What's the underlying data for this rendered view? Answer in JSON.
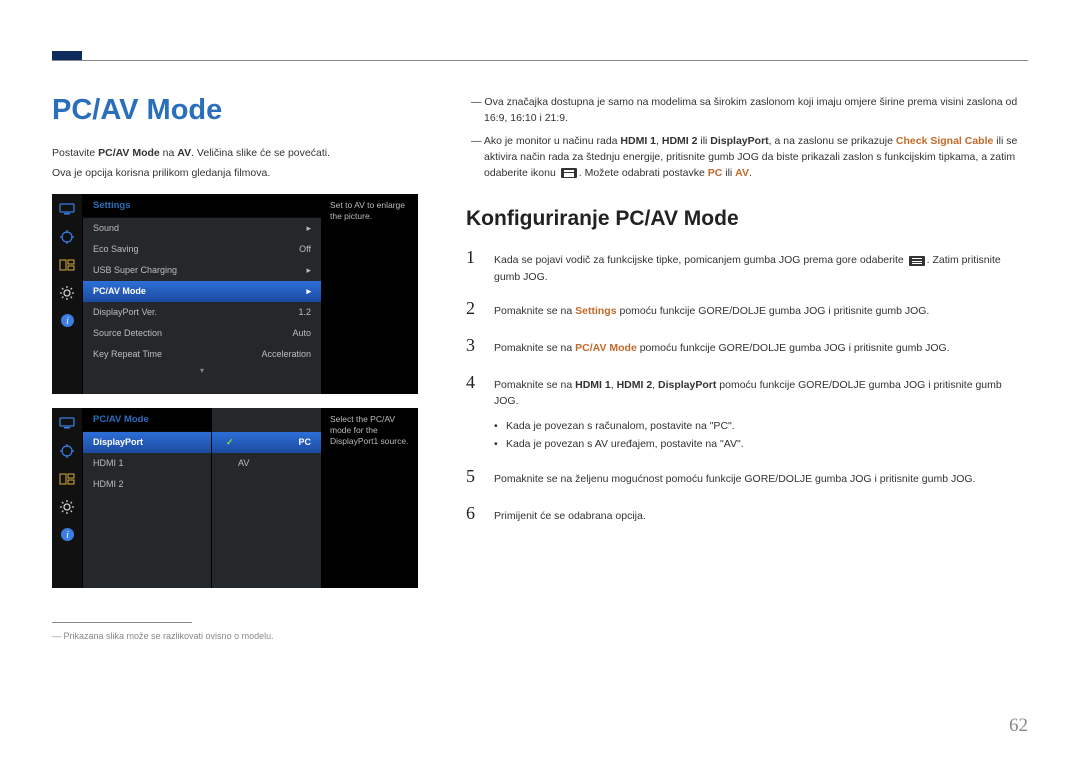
{
  "page_title": "PC/AV Mode",
  "intro_full": "Postavite <b>PC/AV Mode</b> na <b>AV</b>. Veličina slike će se povećati.",
  "intro_line2": "Ova je opcija korisna prilikom gledanja filmova.",
  "osd1": {
    "header": "Settings",
    "rows": [
      {
        "label": "Sound",
        "value": "",
        "arrow": true
      },
      {
        "label": "Eco Saving",
        "value": "Off"
      },
      {
        "label": "USB Super Charging",
        "value": "",
        "arrow": true
      },
      {
        "label": "PC/AV Mode",
        "value": "",
        "arrow": true,
        "selected": true
      },
      {
        "label": "DisplayPort Ver.",
        "value": "1.2"
      },
      {
        "label": "Source Detection",
        "value": "Auto"
      },
      {
        "label": "Key Repeat Time",
        "value": "Acceleration"
      }
    ],
    "help": "Set to AV to enlarge the picture."
  },
  "osd2": {
    "header": "PC/AV Mode",
    "rows": [
      {
        "label": "DisplayPort",
        "selected": true
      },
      {
        "label": "HDMI 1"
      },
      {
        "label": "HDMI 2"
      }
    ],
    "submenu": [
      {
        "label": "PC",
        "selected": true,
        "check": true
      },
      {
        "label": "AV"
      }
    ],
    "help": "Select the PC/AV mode for the DisplayPort1 source."
  },
  "footnote_text": "― Prikazana slika može se razlikovati ovisno o modelu.",
  "notes": {
    "n1": "― Ova značajka dostupna je samo na modelima sa širokim zaslonom koji imaju omjere širine prema visini zaslona od 16:9, 16:10 i 21:9.",
    "n2_pre": "― Ako je monitor u načinu rada ",
    "n2_b1": "HDMI 1",
    "n2_s1": ", ",
    "n2_b2": "HDMI 2",
    "n2_s2": " ili ",
    "n2_b3": "DisplayPort",
    "n2_mid": ", a na zaslonu se prikazuje ",
    "n2_em": "Check Signal Cable",
    "n2_post": " ili se aktivira način rada za štednju energije, pritisnite gumb JOG da biste prikazali zaslon s funkcijskim tipkama, a zatim odaberite ikonu ",
    "n2_tail": ". Možete odabrati postavke ",
    "n2_pc": "PC",
    "n2_or": " ili ",
    "n2_av": "AV",
    "n2_end": "."
  },
  "section_title": "Konfiguriranje PC/AV Mode",
  "steps": {
    "1": {
      "pre": "Kada se pojavi vodič za funkcijske tipke, pomicanjem gumba JOG prema gore odaberite ",
      "post": ". Zatim pritisnite gumb JOG."
    },
    "2": {
      "pre": "Pomaknite se na ",
      "em": "Settings",
      "post": " pomoću funkcije GORE/DOLJE gumba JOG i pritisnite gumb JOG."
    },
    "3": {
      "pre": "Pomaknite se na ",
      "em": "PC/AV Mode",
      "post": " pomoću funkcije GORE/DOLJE gumba JOG i pritisnite gumb JOG."
    },
    "4": {
      "pre": "Pomaknite se na ",
      "b1": "HDMI 1",
      "s1": ", ",
      "b2": "HDMI 2",
      "s2": ", ",
      "b3": "DisplayPort",
      "post": " pomoću funkcije GORE/DOLJE gumba JOG i pritisnite gumb JOG."
    },
    "5": "Pomaknite se na željenu mogućnost pomoću funkcije GORE/DOLJE gumba JOG i pritisnite gumb JOG.",
    "6": "Primijenit će se odabrana opcija."
  },
  "bullets": {
    "b1": "Kada je povezan s računalom, postavite na \"PC\".",
    "b2": "Kada je povezan s AV uređajem, postavite na \"AV\"."
  },
  "page_number": "62"
}
